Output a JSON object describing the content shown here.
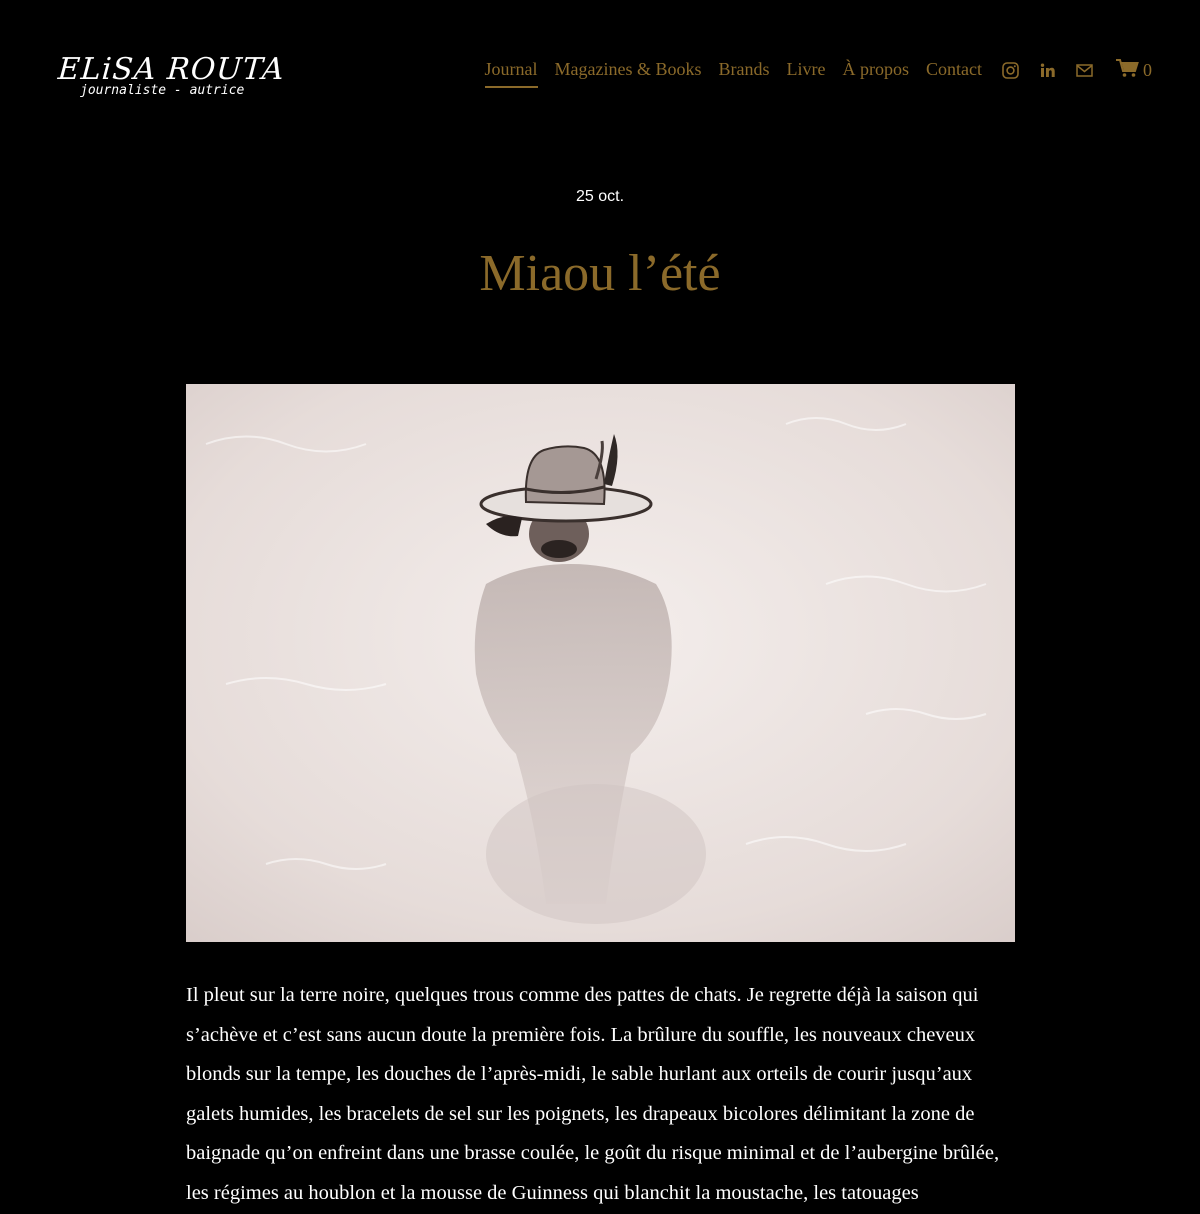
{
  "site": {
    "logo_name": "ELiSA ROUTA",
    "logo_tagline": "journaliste - autrice"
  },
  "nav": {
    "items": [
      {
        "label": "Journal",
        "active": true
      },
      {
        "label": "Magazines & Books",
        "active": false
      },
      {
        "label": "Brands",
        "active": false
      },
      {
        "label": "Livre",
        "active": false
      },
      {
        "label": "À propos",
        "active": false
      },
      {
        "label": "Contact",
        "active": false
      }
    ],
    "icons": [
      "instagram-icon",
      "linkedin-icon",
      "email-icon",
      "cart-icon"
    ],
    "cart_count": "0"
  },
  "post": {
    "date": "25 oct.",
    "title": "Miaou l’été",
    "body": "Il pleut sur la terre noire, quelques trous comme des pattes de chats. Je regrette déjà la saison qui s’achève et c’est sans aucun doute la première fois. La brûlure du souffle, les nouveaux cheveux blonds sur la tempe, les douches de l’après-midi, le sable hurlant aux orteils de courir jusqu’aux galets humides, les bracelets de sel sur les poignets, les drapeaux bicolores délimitant la zone de baignade qu’on enfreint dans une brasse coulée, le goût du risque minimal et de l’aubergine brûlée, les régimes au houblon et la mousse de Guinness qui blanchit la moustache, les tatouages"
  },
  "colors": {
    "background": "#000000",
    "accent": "#8b6a2a",
    "text": "#ffffff"
  }
}
